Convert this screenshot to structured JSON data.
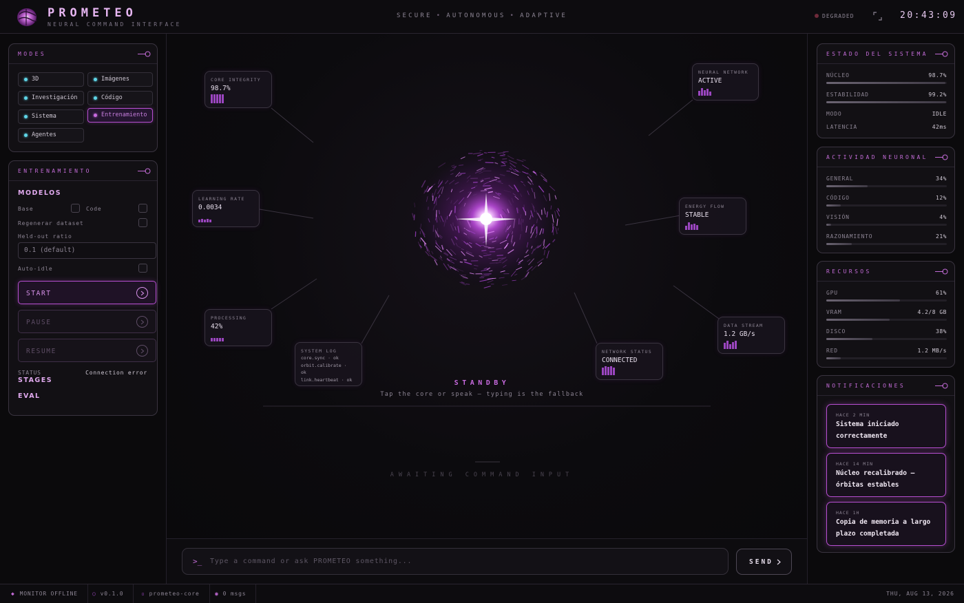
{
  "header": {
    "brand": "PROMETEO",
    "subtitle": "NEURAL COMMAND INTERFACE",
    "tagline": [
      "SECURE",
      "AUTONOMOUS",
      "ADAPTIVE"
    ],
    "status": "DEGRADED",
    "clock": "20:43:09"
  },
  "modes": {
    "title": "MODES",
    "items": [
      {
        "label": "3D"
      },
      {
        "label": "Imágenes"
      },
      {
        "label": "Investigación"
      },
      {
        "label": "Código"
      },
      {
        "label": "Sistema"
      },
      {
        "label": "Entrenamiento",
        "active": true
      },
      {
        "label": "Agentes"
      }
    ]
  },
  "training": {
    "title": "ENTRENAMIENTO",
    "models_label": "MODELOS",
    "base_label": "Base",
    "code_label": "Code",
    "regen_label": "Regenerar dataset",
    "holdout_label": "Held-out ratio",
    "holdout_placeholder": "0.1 (default)",
    "autoidle_label": "Auto-idle",
    "start_label": "START",
    "pause_label": "PAUSE",
    "resume_label": "RESUME",
    "status_key": "STATUS",
    "status_value": "Connection error",
    "stages_label": "STAGES",
    "eval_label": "EVAL"
  },
  "nodes": {
    "core": {
      "key": "CORE INTEGRITY",
      "value": "98.7%"
    },
    "neural": {
      "key": "NEURAL NETWORK",
      "value": "ACTIVE"
    },
    "learning": {
      "key": "LEARNING RATE",
      "value": "0.0034"
    },
    "energy": {
      "key": "ENERGY FLOW",
      "value": "STABLE"
    },
    "processing": {
      "key": "PROCESSING",
      "value": "42%"
    },
    "syslog": {
      "key": "SYSTEM LOG",
      "lines": "core.sync · ok\norbit.calibrate ·\nok\nlink.heartbeat · ok"
    },
    "netstatus": {
      "key": "NETWORK STATUS",
      "value": "CONNECTED"
    },
    "datastream": {
      "key": "DATA STREAM",
      "value": "1.2 GB/s"
    }
  },
  "stage": {
    "state": "STANDBY",
    "hint": "Tap the core or speak — typing is the fallback",
    "awaiting": "AWAITING COMMAND INPUT"
  },
  "command": {
    "prompt": ">_",
    "placeholder": "Type a command or ask PROMETEO something...",
    "send_label": "SEND"
  },
  "system_state": {
    "title": "ESTADO DEL SISTEMA",
    "rows": [
      {
        "label": "NÚCLEO",
        "value": "98.7%",
        "level": 0.987
      },
      {
        "label": "ESTABILIDAD",
        "value": "99.2%",
        "level": 0.992
      },
      {
        "label": "MODO",
        "value": "IDLE"
      },
      {
        "label": "LATENCIA",
        "value": "42ms"
      }
    ]
  },
  "neural_activity": {
    "title": "ACTIVIDAD NEURONAL",
    "rows": [
      {
        "label": "GENERAL",
        "value": "34%",
        "level": 0.34
      },
      {
        "label": "CÓDIGO",
        "value": "12%",
        "level": 0.12
      },
      {
        "label": "VISIÓN",
        "value": "4%",
        "level": 0.04
      },
      {
        "label": "RAZONAMIENTO",
        "value": "21%",
        "level": 0.21
      }
    ]
  },
  "resources": {
    "title": "RECURSOS",
    "rows": [
      {
        "label": "GPU",
        "value": "61%",
        "level": 0.61
      },
      {
        "label": "VRAM",
        "value": "4.2/8 GB",
        "level": 0.525
      },
      {
        "label": "DISCO",
        "value": "38%",
        "level": 0.38
      },
      {
        "label": "RED",
        "value": "1.2 MB/s",
        "level": 0.12
      }
    ]
  },
  "notifications": {
    "title": "NOTIFICACIONES",
    "items": [
      {
        "time": "HACE 2 MIN",
        "message": "Sistema iniciado correctamente"
      },
      {
        "time": "HACE 14 MIN",
        "message": "Núcleo recalibrado — órbitas estables"
      },
      {
        "time": "HACE 1H",
        "message": "Copia de memoria a largo plazo completada"
      }
    ]
  },
  "footer": {
    "monitor": "MONITOR OFFLINE",
    "version": "v0.1.0",
    "project": "prometeo-core",
    "msgs": "0 msgs",
    "date": "THU, AUG 13, 2026"
  },
  "colors": {
    "accent": "#c26bd6",
    "accent_bright": "#e7b6f2",
    "led_cyan": "#5fd6e8",
    "background": "#0b0a0c"
  }
}
